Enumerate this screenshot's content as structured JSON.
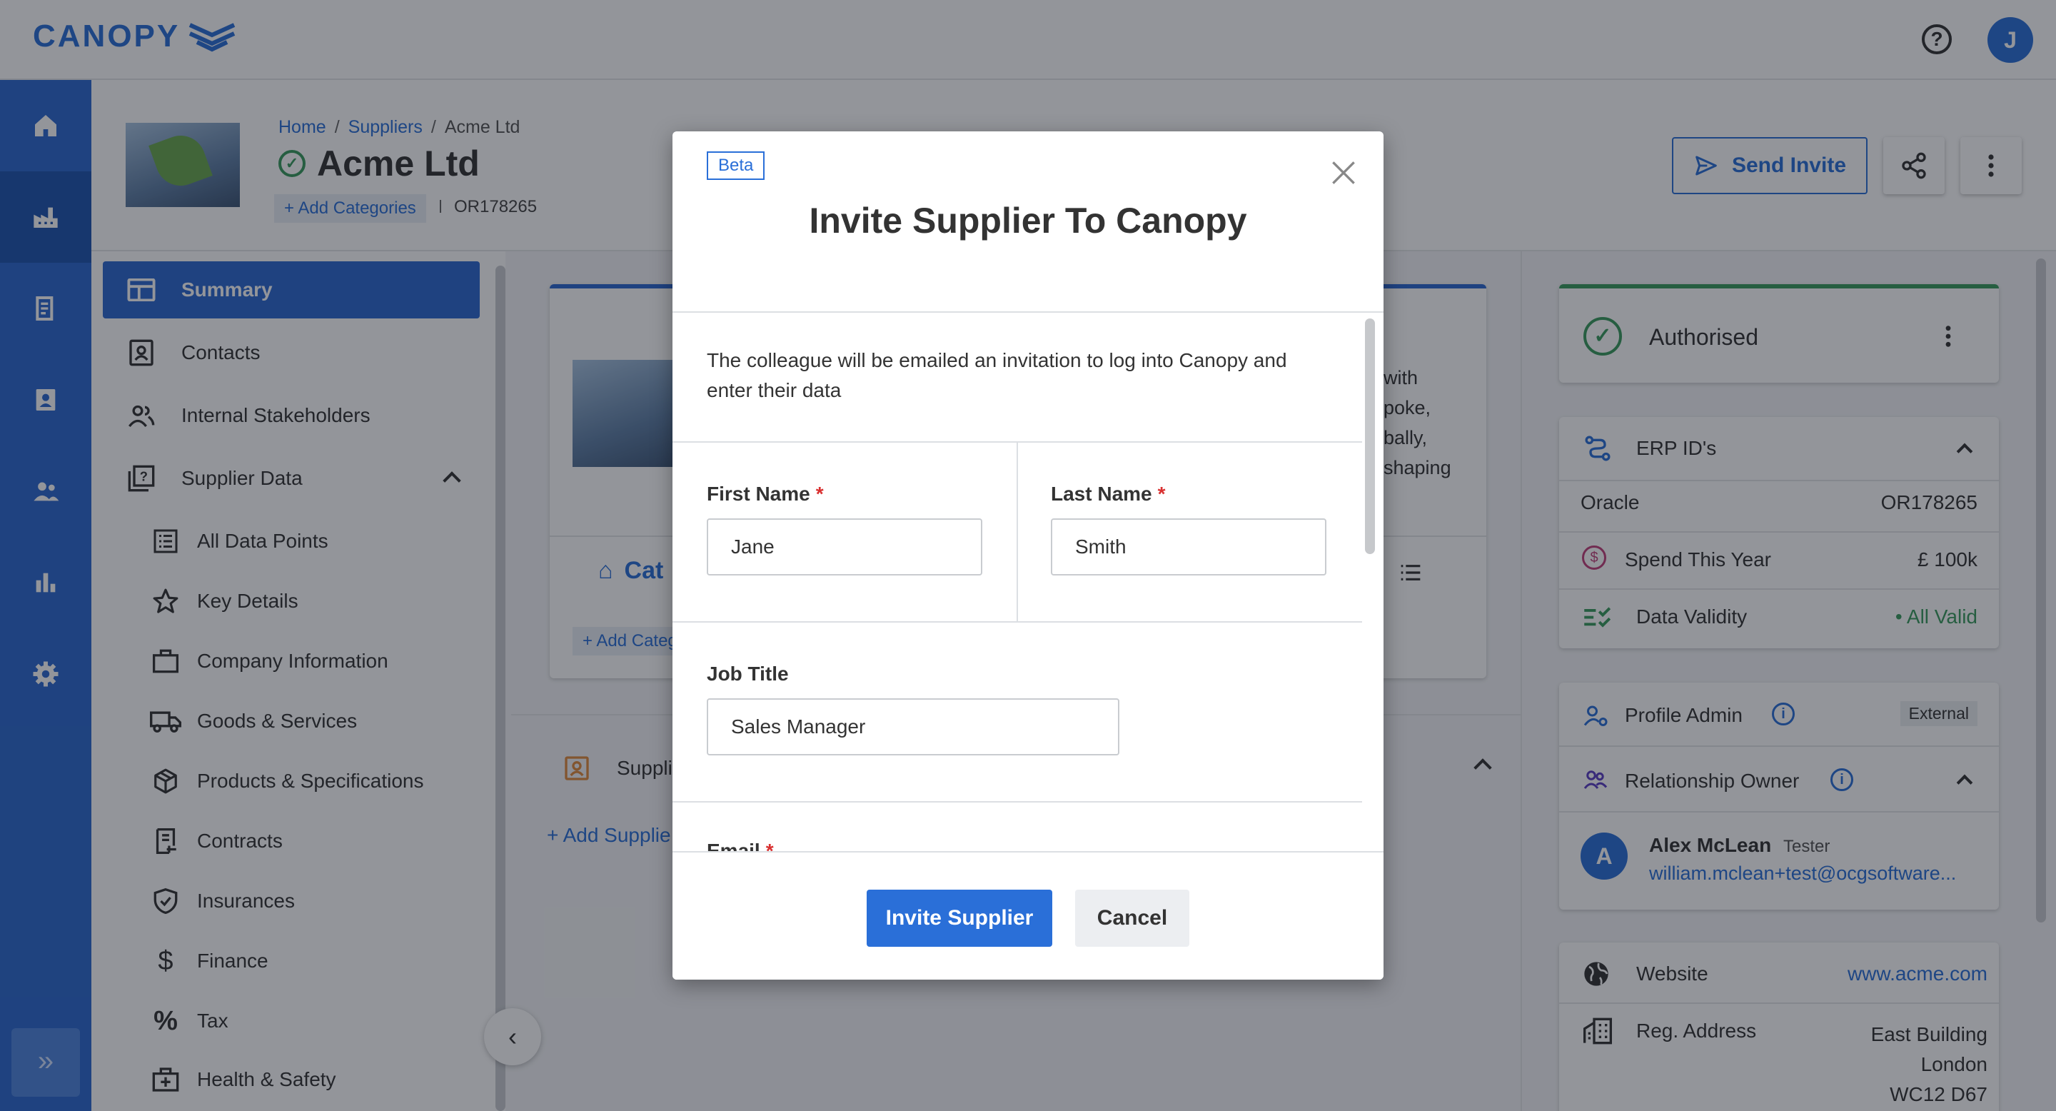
{
  "app": {
    "logo": "CANOPY",
    "help": "?",
    "user_initial": "J"
  },
  "breadcrumb": {
    "home": "Home",
    "suppliers": "Suppliers",
    "current": "Acme Ltd"
  },
  "company": {
    "name": "Acme Ltd",
    "add_categories": "+ Add Categories",
    "erp_code": "OR178265"
  },
  "header_actions": {
    "send_invite": "Send Invite"
  },
  "sidebar": {
    "items": [
      {
        "label": "Summary",
        "icon": "dashboard-icon"
      },
      {
        "label": "Contacts",
        "icon": "contacts-icon"
      },
      {
        "label": "Internal Stakeholders",
        "icon": "people-icon"
      },
      {
        "label": "Supplier Data",
        "icon": "data-icon"
      }
    ],
    "sub_items": [
      {
        "label": "All Data Points",
        "icon": "list-icon"
      },
      {
        "label": "Key Details",
        "icon": "star-icon"
      },
      {
        "label": "Company Information",
        "icon": "briefcase-icon"
      },
      {
        "label": "Goods & Services",
        "icon": "truck-icon"
      },
      {
        "label": "Products & Specifications",
        "icon": "box-icon"
      },
      {
        "label": "Contracts",
        "icon": "contract-icon"
      },
      {
        "label": "Insurances",
        "icon": "shield-icon"
      },
      {
        "label": "Finance",
        "icon": "dollar-icon"
      },
      {
        "label": "Tax",
        "icon": "percent-icon"
      },
      {
        "label": "Health & Safety",
        "icon": "health-icon"
      }
    ]
  },
  "main": {
    "cat_label": "Cat",
    "add_cat": "+ Add Categ",
    "about_snippets": [
      "with",
      "poke,",
      "bally,",
      "shaping"
    ],
    "section_label": "Suppli",
    "add_supplier": "+ Add Supplie"
  },
  "right_panel": {
    "status": "Authorised",
    "erp_title": "ERP ID's",
    "erp_rows": [
      {
        "label": "Oracle",
        "value": "OR178265"
      }
    ],
    "spend_label": "Spend This Year",
    "spend_value": "£ 100k",
    "validity_label": "Data Validity",
    "validity_value": "• All Valid",
    "profile_admin_label": "Profile Admin",
    "profile_admin_badge": "External",
    "relationship_owner_label": "Relationship Owner",
    "owner": {
      "initial": "A",
      "name": "Alex McLean",
      "role": "Tester",
      "email": "william.mclean+test@ocgsoftware..."
    },
    "website_label": "Website",
    "website_value": "www.acme.com",
    "address_label": "Reg. Address",
    "address_lines": [
      "East Building",
      "London",
      "WC12 D67"
    ]
  },
  "modal": {
    "badge": "Beta",
    "title": "Invite Supplier To Canopy",
    "description": "The colleague will be emailed an invitation to log into Canopy and enter their data",
    "first_name_label": "First Name",
    "first_name_value": "Jane",
    "last_name_label": "Last Name",
    "last_name_value": "Smith",
    "job_title_label": "Job Title",
    "job_title_value": "Sales Manager",
    "email_label": "Email",
    "required_mark": "*",
    "invite_button": "Invite Supplier",
    "cancel_button": "Cancel"
  },
  "colors": {
    "primary": "#2a6fd8",
    "rail": "#2c69cf",
    "success": "#3a9b5d",
    "required": "#d93030"
  }
}
